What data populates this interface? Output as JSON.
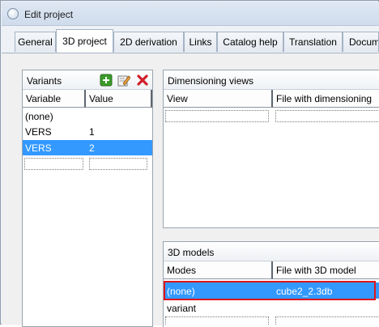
{
  "window": {
    "title": "Edit project"
  },
  "tabs": [
    {
      "label": "General"
    },
    {
      "label": "3D project"
    },
    {
      "label": "2D derivation"
    },
    {
      "label": "Links"
    },
    {
      "label": "Catalog help"
    },
    {
      "label": "Translation"
    },
    {
      "label": "Docum"
    }
  ],
  "variants": {
    "title": "Variants",
    "columns": [
      "Variable",
      "Value"
    ],
    "rows": [
      {
        "variable": "(none)",
        "value": ""
      },
      {
        "variable": "VERS",
        "value": "1"
      },
      {
        "variable": "VERS",
        "value": "2"
      }
    ],
    "toolbar": [
      "add-icon",
      "edit-icon",
      "delete-icon"
    ]
  },
  "dimensioning": {
    "title": "Dimensioning views",
    "columns": [
      "View",
      "File with dimensioning"
    ]
  },
  "models": {
    "title": "3D models",
    "columns": [
      "Modes",
      "File with 3D model"
    ],
    "rows": [
      {
        "mode": "(none)",
        "file": "cube2_2.3db"
      },
      {
        "mode": "variant",
        "file": ""
      }
    ]
  },
  "colors": {
    "selection": "#3399ff",
    "highlight": "#e1141b"
  }
}
